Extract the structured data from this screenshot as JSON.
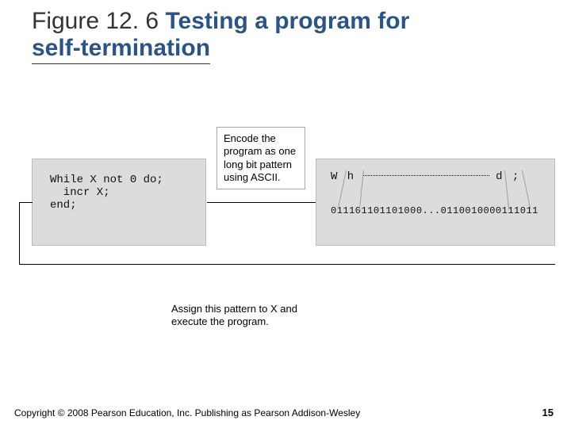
{
  "title": {
    "label": "Figure 12. 6 ",
    "text_line1": "Testing a program for",
    "text_line2": "self-termination"
  },
  "diagram": {
    "code": "While X not 0 do;\n  incr X;\nend;",
    "encode_label": "Encode the program as one long bit pattern using ASCII.",
    "ascii_prefix": "W h",
    "ascii_suffix": "d ;",
    "bits": "011101101101000...0110010000111011",
    "assign_label": "Assign this pattern to X and execute the program."
  },
  "footer": {
    "copyright": "Copyright © 2008 Pearson Education, Inc. Publishing as Pearson Addison-Wesley",
    "page": "15"
  }
}
